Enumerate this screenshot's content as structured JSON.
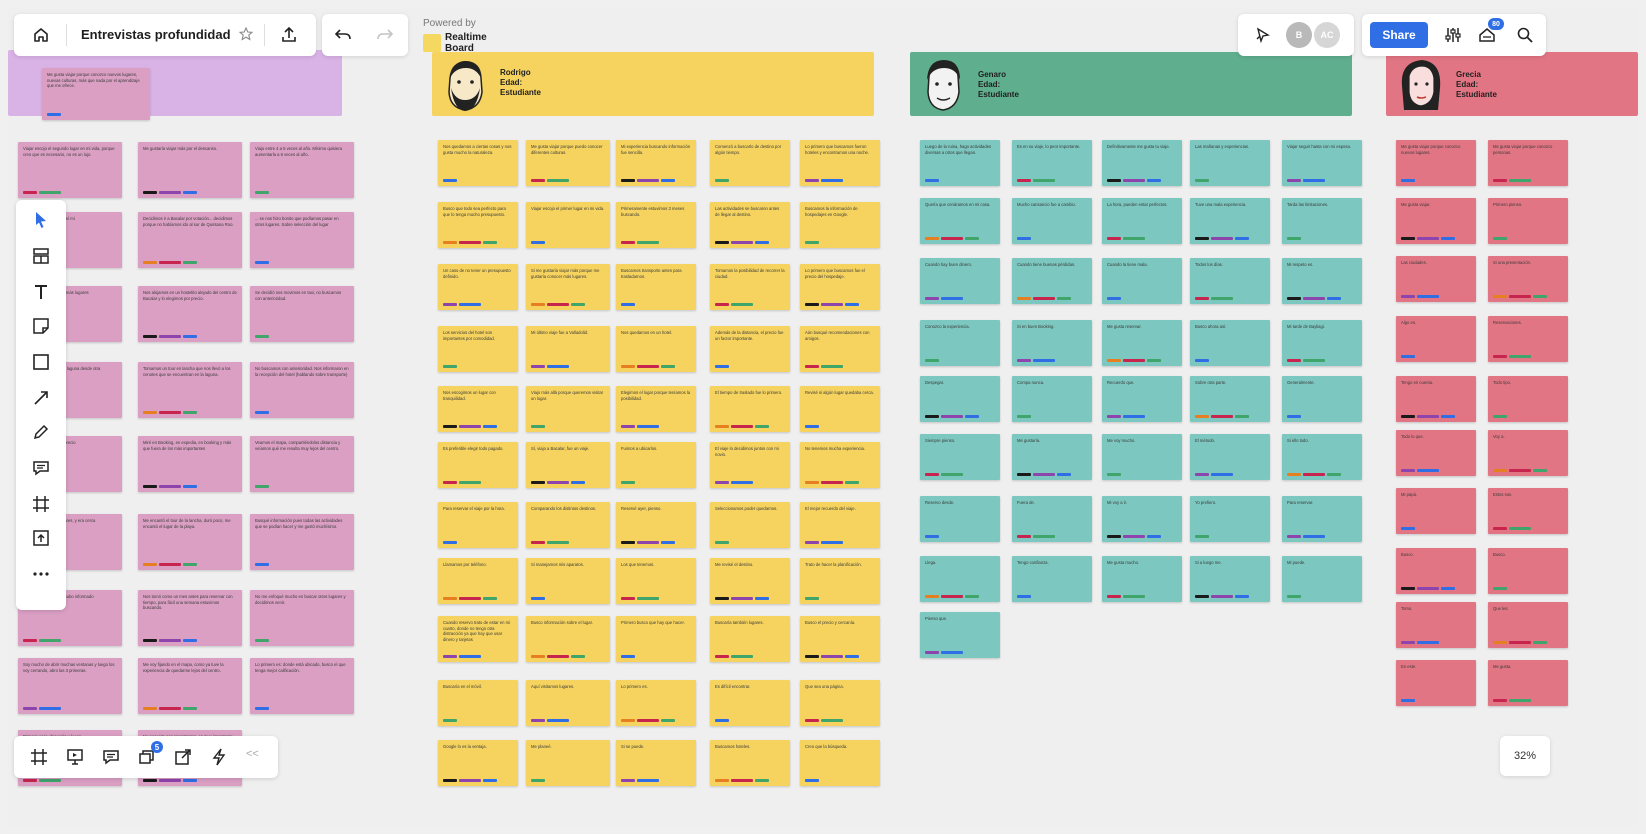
{
  "toolbar": {
    "board_title": "Entrevistas profundidad",
    "powered_by": "Powered by",
    "brand_line1": "Realtime",
    "brand_line2": "Board"
  },
  "top_right": {
    "avatars": [
      "B",
      "AC"
    ],
    "share_label": "Share",
    "notifications_count": "80"
  },
  "bottom_bar": {
    "comments_badge": "5",
    "collapse_label": "<<"
  },
  "zoom": {
    "level": "32%"
  },
  "personas": [
    {
      "name": "Rodrigo",
      "age_label": "Edad:",
      "role": "Estudiante"
    },
    {
      "name": "Genaro",
      "age_label": "Edad:",
      "role": "Estudiante"
    },
    {
      "name": "Grecia",
      "age_label": "Edad:",
      "role": "Estudiante"
    }
  ],
  "colors": {
    "pink": "#da9fc3",
    "purple": "#d9b2e6",
    "yellow": "#f5d35e",
    "teal": "#7cc7bf",
    "green_header": "#5fae8e",
    "red": "#e27583",
    "accent_blue": "#2f6ee5"
  },
  "notes": {
    "pink": [
      "Me gusta viajar porque conozco nuevos lugares, nuevas culturas, más que nada por el aprendizaje que me ofrece.",
      "Viajar escojo el segundo lugar en mi vida, porque creo que es necesario, no es un lujo.",
      "Me gustaría viajar más por el descanso.",
      "Viajo entre 4 a 5 veces al año. Mínimo quisiera aumentarla a 6 veces al año.",
      "... en amigo y porque así mi",
      "Decidimos ir a Bacalar por votación... decidimos porque no habíamos ido al sur de Quintana Roo.",
      "... se nos hizo bonito que podíamos pasar en otros lugares. Sabre selección del lugar",
      "... viajar distancia, que más lugares",
      "Nos alojamos en un hostelito alejado del centro de Bacalar y lo elegimos por precio.",
      "Se decidió nos movimos en taxi, no buscamos con anterioridad.",
      "... la ciudad a probar el laguna desde otra",
      "Tomamos un tour en lancha que nos llevó a los cenotes que se encuentran en la laguna.",
      "No buscamos con anterioridad. Nos informaron en la recepción del hotel (hablando sobre transporte)",
      "... de hospedaje, ... el precio",
      "Miré en Booking, en expedia, en booking y más que fuera de los más importantes",
      "Veamos el mapa, compartiéndolos distancia y veíamos qué me resulta muy lejos del centro.",
      "... comparando las lugares, y era cerca",
      "Me encantó el tour de la lancha, duró poco, me encantó el lugar de la playa.",
      "Busqué información pues todas las actividades que se podían hacer y me gustó muchísimo.",
      "... mucho, todo lo que hubo informado",
      "Nos tomó como un mes antes para reservar con tiempo, para fácil una semana estuvimos buscando.",
      "No me enfoqué mucho en buscar otros lugares y decidimos venir.",
      "Soy mucho de abrir muchas ventanas y luego los voy cerrando, abro las 3 primeras.",
      "Me voy fijando en el mapa, como ya tuve la experiencia de quedarme lejos del centro.",
      "Lo primero es: donde está ubicado, busco el que tenga mejor calificación.",
      "Primero es la ubicación y luego",
      "No necesito son importantes, es muy importante el aire acondicionado."
    ],
    "yellow": [
      "Nos quedamos a ciertas cosas y nos gusta mucho la naturaleza.",
      "Me gusta viajar porque puedo conocer diferentes culturas.",
      "Mi experiencia buscando información fue sencilla.",
      "Comenzó a buscarlo de destino por algún tiempo.",
      "Lo primero que buscamos fueron hoteles y encontramos una noche.",
      "Busco que todo sea perfecto para que lo tenga mucho presupuesto.",
      "Viajar escojo el primer lugar en mi vida.",
      "Primeramente estuvimos 3 meses buscando.",
      "Las actividades se buscaron antes de llegar al destino.",
      "Buscamos la información de hospedajes en Google.",
      "Un caso de no tener un presupuesto definido.",
      "Si me gustaría viajar más porque me gustaría conocer más lugares.",
      "Buscamos transporte antes para trasladarnos.",
      "Tomamos la posibilidad de recorrer la ciudad.",
      "Lo primero que buscamos fue el precio del hospedaje.",
      "Los servicios del hotel son importantes por comodidad.",
      "Mi último viaje fue a Valladolid.",
      "Nos quedamos en un hotel.",
      "Además de la distancia, el precio fue un factor importante.",
      "Aún busqué recomendaciones con amigos.",
      "Nos escogimos un lugar con tranquilidad.",
      "Viajo más allá porque queremos visitar un lugar.",
      "Elegimos el lugar porque teníamos la posibilidad.",
      "El tiempo de traslado fue lo primero.",
      "Revisé si algún lugar quedaba cerca.",
      "Es preferible elegir todo pagado.",
      "Sí, viajo a Bacalar, fue un viaje.",
      "Fuimos a ubicarlos.",
      "El viaje lo decidimos juntos con mi novio.",
      "No tenemos mucha experiencia.",
      "Para reservar el viaje por la hora.",
      "Comparando los distintos destinos.",
      "Reservé ayer, pienso.",
      "Seleccionamos poder quedarnos.",
      "El mejor recuerdo del viaje.",
      "Llamamos por teléfono.",
      "Si manejamos mis aparatos.",
      "Los que tenemos.",
      "Me revisé el destino.",
      "Trato de hacer la planificación.",
      "Cuando reservo trato de estar en mi cuarto, donde no tengo otra distracción ya que hay que usar dinero y tarjetas",
      "Busco información sobre el lugar.",
      "Primero busco que hay que hacer.",
      "Buscaría también lugares.",
      "Busco el precio y cercanía.",
      "Buscaría en el móvil.",
      "Aquí visitamos lugares.",
      "Lo primero es.",
      "Es difícil encontrar.",
      "Que sea una página.",
      "Google lo es la ventaja.",
      "Me planeé.",
      "Si se puede.",
      "Buscamos hoteles.",
      "Creo que la búsqueda."
    ],
    "teal": [
      "Luego de la ruina, hago actividades diversas a otros que llegan.",
      "Es en su viaje, lo peor importante.",
      "Definitivamente me gusta tu viaje.",
      "Las mañanas y experiencias.",
      "Viajar seguir hasta con mi esposa.",
      "Quería que cenáramos en mi casa.",
      "Mucho cansancio fue a cambio.",
      "La hora, pueden estar perfectos.",
      "Tuve una mala experiencia.",
      "Tarda las limitaciones.",
      "Cuando hay buen dinero.",
      "Cuando tiene buenas pérdidas.",
      "Cuando la tiene mala.",
      "Todos los días.",
      "Mi respeto es.",
      "Conozco la experiencia.",
      "Si en buen Booking.",
      "Me gusta reservar.",
      "Busco ahora así.",
      "Mi tarde de Bayliagi.",
      "Despegar.",
      "Compa nunca.",
      "Recuerdo que.",
      "Sobre otra parte.",
      "Generalmente.",
      "Siempre pienso.",
      "Me gustaría.",
      "Me voy mucho.",
      "El método.",
      "Si ello todo.",
      "Reservo desde.",
      "Fuera de.",
      "Mi voy a ir.",
      "Yo prefiero.",
      "Para reservar.",
      "Llega.",
      "Tengo confianza.",
      "Me gusta mucho.",
      "Si a luego me.",
      "Mi puede.",
      "Pienso que."
    ],
    "red": [
      "Me gusta viajar porque conozco nuevos lugares.",
      "Me gusta viajar porque conozco personas.",
      "Me gusta viajar.",
      "Primero pienso.",
      "Las ciudades.",
      "Si una presentación.",
      "Algo es.",
      "Reservaciones.",
      "Tengo en cuenta.",
      "Todo tipo.",
      "Todo lo que.",
      "Voy a.",
      "Mi papá.",
      "Estos son.",
      "Busco.",
      "Busco.",
      "Tomo.",
      "Que les.",
      "En este.",
      "Me gusta."
    ]
  }
}
